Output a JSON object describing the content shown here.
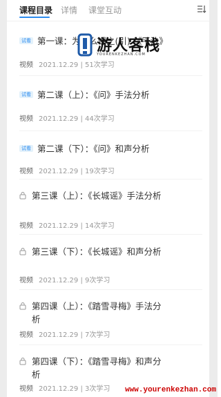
{
  "tabs": [
    {
      "label": "课程目录",
      "active": true
    },
    {
      "label": "详情",
      "active": false
    },
    {
      "label": "课堂互动",
      "active": false
    }
  ],
  "sort_icon": "sort-list-icon",
  "lessons": [
    {
      "badge": "试看",
      "locked": false,
      "title": "第一课：为什么课之(引) 《平沙》",
      "kind": "视频",
      "date": "2021.12.29",
      "views": "51次学习"
    },
    {
      "badge": "试看",
      "locked": false,
      "title": "第二课（上）：《问》手法分析",
      "kind": "视频",
      "date": "2021.12.29",
      "views": "44次学习"
    },
    {
      "badge": "试看",
      "locked": false,
      "title": "第二课（下）：《问》和声分析",
      "kind": "视频",
      "date": "2021.12.29",
      "views": "19次学习"
    },
    {
      "badge": "",
      "locked": true,
      "title": "第三课（上）：《长城谣》手法分析",
      "kind": "视频",
      "date": "2021.12.29",
      "views": "14次学习"
    },
    {
      "badge": "",
      "locked": true,
      "title": "第三课（下）：《长城谣》和声分析",
      "kind": "视频",
      "date": "2021.12.29",
      "views": "9次学习"
    },
    {
      "badge": "",
      "locked": true,
      "title": "第四课（上）：《踏雪寻梅》手法分析",
      "kind": "视频",
      "date": "2021.12.29",
      "views": "7次学习"
    },
    {
      "badge": "",
      "locked": true,
      "title": "第四课（下）：《踏雪寻梅》和声分析",
      "kind": "视频",
      "date": "2021.12.29",
      "views": "3次学习"
    }
  ],
  "watermark": {
    "brand": "游人客栈",
    "sub": "YOURENKEZHAN.COM",
    "url": "www.yourenkezhan.com"
  },
  "colors": {
    "accent": "#2c8cf0",
    "badge_bg": "#e3f1fb",
    "watermark_url": "#cc0000"
  }
}
